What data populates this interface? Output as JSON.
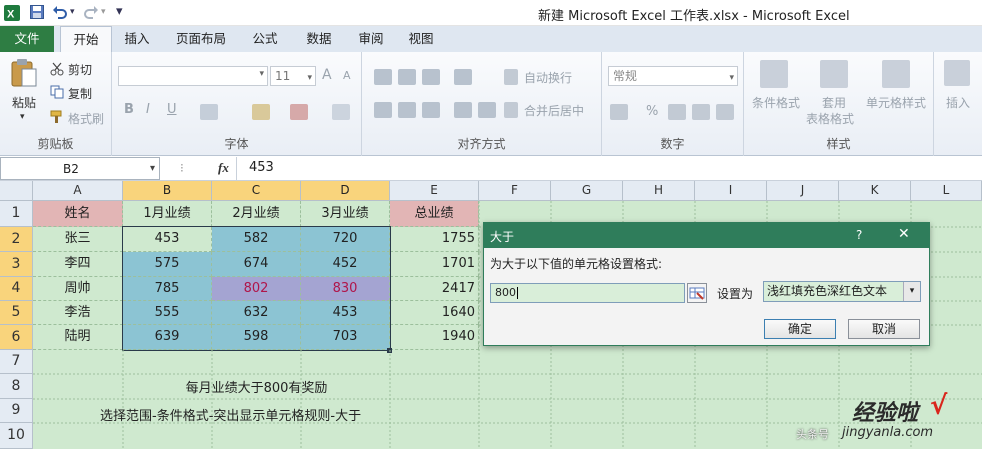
{
  "window": {
    "title": "新建 Microsoft Excel 工作表.xlsx  -  Microsoft Excel"
  },
  "quick_access": {
    "menu_glyph": "▾"
  },
  "tabs": [
    "文件",
    "开始",
    "插入",
    "页面布局",
    "公式",
    "数据",
    "审阅",
    "视图"
  ],
  "ribbon": {
    "clipboard": {
      "group": "剪贴板",
      "paste": "粘贴",
      "cut": "剪切",
      "copy": "复制",
      "format_painter": "格式刷"
    },
    "font": {
      "group": "字体",
      "size": "11",
      "bold": "B",
      "italic": "I",
      "underline": "U",
      "grow": "A",
      "shrink": "A"
    },
    "alignment": {
      "group": "对齐方式",
      "wrap": "自动换行",
      "merge": "合并后居中"
    },
    "number": {
      "group": "数字",
      "format": "常规",
      "percent": "%"
    },
    "styles": {
      "group": "样式",
      "conditional": "条件格式",
      "table_line1": "套用",
      "table_line2": "表格格式",
      "cell_styles": "单元格样式"
    },
    "cells": {
      "insert": "插入"
    }
  },
  "formula_bar": {
    "name_box": "B2",
    "fx": "fx",
    "value": "453"
  },
  "columns": [
    "A",
    "B",
    "C",
    "D",
    "E",
    "F",
    "G",
    "H",
    "I",
    "J",
    "K",
    "L"
  ],
  "rows": [
    "1",
    "2",
    "3",
    "4",
    "5",
    "6",
    "7",
    "8",
    "9",
    "10"
  ],
  "sheet": {
    "headers": [
      "姓名",
      "1月业绩",
      "2月业绩",
      "3月业绩",
      "总业绩"
    ],
    "data": [
      [
        "张三",
        "453",
        "582",
        "720",
        "1755"
      ],
      [
        "李四",
        "575",
        "674",
        "452",
        "1701"
      ],
      [
        "周帅",
        "785",
        "802",
        "830",
        "2417"
      ],
      [
        "李浩",
        "555",
        "632",
        "453",
        "1640"
      ],
      [
        "陆明",
        "639",
        "598",
        "703",
        "1940"
      ]
    ],
    "note1": "每月业绩大于800有奖励",
    "note2": "选择范围-条件格式-突出显示单元格规则-大于"
  },
  "dialog": {
    "title": "大于",
    "help": "?",
    "close": "✕",
    "prompt": "为大于以下值的单元格设置格式:",
    "value": "800",
    "set_as_label": "设置为",
    "format_option": "浅红填充色深红色文本",
    "ok": "确定",
    "cancel": "取消"
  },
  "watermark": {
    "main": "经验啦",
    "check": "√",
    "domain": "jingyanla.com",
    "user": "头条号"
  },
  "colors": {
    "file_tab": "#2e7d43",
    "dialog_title": "#2f7d5b",
    "sheet_bg": "#cfe9cf",
    "header_fill": "#e2b5b5",
    "range_fill": "#8cc4d3",
    "highlight_fill": "#a4a4d2",
    "highlight_text": "#b0154a"
  }
}
